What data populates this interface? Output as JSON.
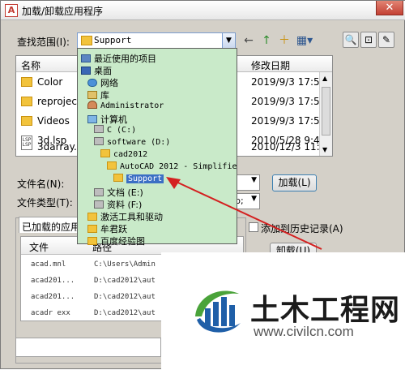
{
  "window": {
    "title": "加载/卸载应用程序",
    "close_label": "✕"
  },
  "toolbar": {
    "look_in_label": "查找范围(I):",
    "look_in_value": "Support",
    "back_icon": "←",
    "up_icon": "↑",
    "new_folder_icon": "＋",
    "views_icon": "▦▾"
  },
  "side_buttons": [
    "🔍",
    "⊡",
    "✎"
  ],
  "file_list": {
    "headers": {
      "name": "名称",
      "modified": "修改日期"
    },
    "rows": [
      {
        "name": "Color",
        "date": "2019/9/3 17:59",
        "type": "folder"
      },
      {
        "name": "reproject",
        "date": "2019/9/3 17:59",
        "type": "folder"
      },
      {
        "name": "Videos",
        "date": "2019/9/3 17:59",
        "type": "folder"
      },
      {
        "name": "3d.lsp",
        "date": "2010/5/28 9:40",
        "type": "file"
      },
      {
        "name": "3darray.ls",
        "date": "2010/12/3 11:58",
        "type": "file"
      }
    ],
    "file_icon_label": "LSP"
  },
  "filename": {
    "label": "文件名(N):",
    "type_label": "文件类型(T):",
    "type_value_tail": "b;",
    "load_button": "加载(L)"
  },
  "loaded_apps": {
    "tab_label": "已加载的应用程",
    "history_label": "添加到历史记录(A)",
    "unload_button": "卸载(U)",
    "headers": {
      "file": "文件",
      "path": "路径"
    },
    "rows": [
      {
        "file": "acad.mnl",
        "path": "C:\\Users\\Admin"
      },
      {
        "file": "acad201...",
        "path": "D:\\cad2012\\aut"
      },
      {
        "file": "acad201...",
        "path": "D:\\cad2012\\aut"
      },
      {
        "file": "acadr exx",
        "path": "D:\\cad2012\\aut"
      }
    ]
  },
  "dropdown_items": [
    {
      "label": "最近使用的项目",
      "icon": "recent-icon",
      "mono": false
    },
    {
      "label": "桌面",
      "icon": "desktop-icon",
      "mono": false
    },
    {
      "label": "网络",
      "icon": "network-icon",
      "mono": false
    },
    {
      "label": "库",
      "icon": "library-icon",
      "mono": false
    },
    {
      "label": "Administrator",
      "icon": "user-icon",
      "mono": true
    },
    {
      "label": "计算机",
      "icon": "computer-icon",
      "mono": false
    },
    {
      "label": "C (C:)",
      "icon": "drive-icon",
      "mono": true
    },
    {
      "label": "software (D:)",
      "icon": "drive-icon",
      "mono": true
    },
    {
      "label": "cad2012",
      "icon": "folder-icon",
      "mono": true
    },
    {
      "label": "AutoCAD 2012 - Simplifie",
      "icon": "folder-icon",
      "mono": true
    },
    {
      "label": "Support",
      "icon": "folder-icon",
      "mono": true,
      "selected": true
    },
    {
      "label": "文档 (E:)",
      "icon": "drive-icon",
      "mono": false
    },
    {
      "label": "资料 (F:)",
      "icon": "drive-icon",
      "mono": false
    },
    {
      "label": "激活工具和驱动",
      "icon": "folder-icon",
      "mono": false
    },
    {
      "label": "牟君跃",
      "icon": "folder-icon",
      "mono": false
    },
    {
      "label": "百度经验图",
      "icon": "folder-icon",
      "mono": false
    }
  ],
  "watermark": {
    "title": "土木工程网",
    "url": "www.civilcn.com"
  },
  "colors": {
    "dropdown_bg": "#c9eac9",
    "selection": "#3b6fc4",
    "arrow": "#d42020",
    "logo_green": "#4aa33a",
    "logo_blue": "#1f5fa8"
  }
}
